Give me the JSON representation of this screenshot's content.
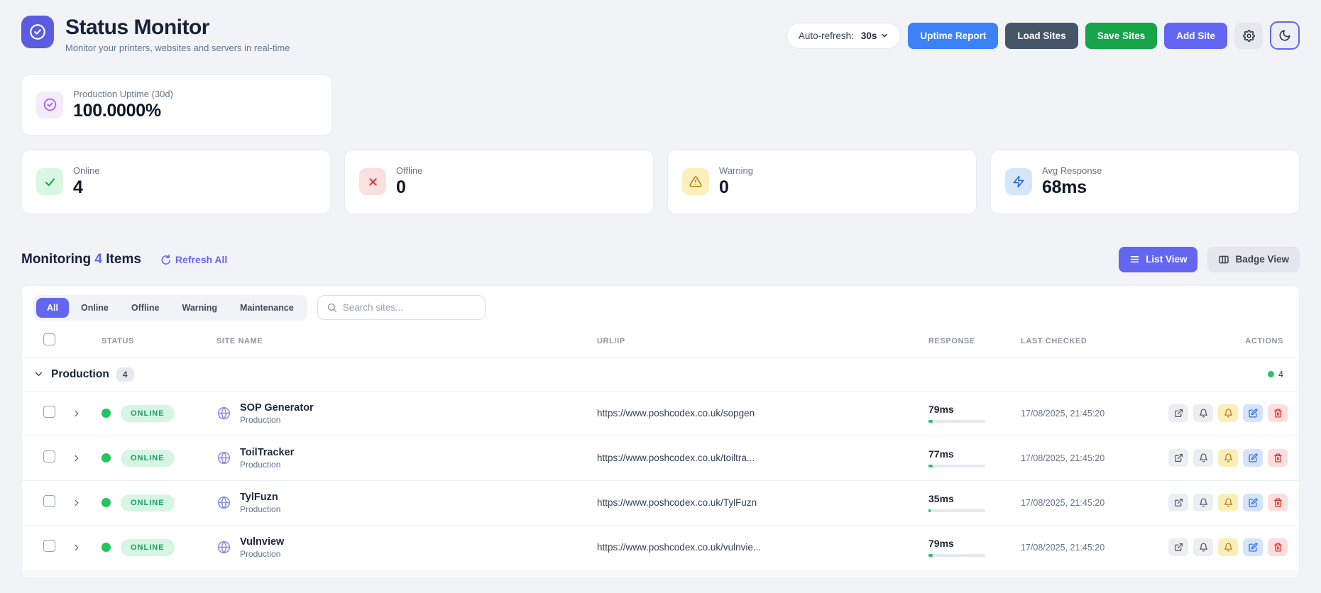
{
  "header": {
    "title": "Status Monitor",
    "subtitle": "Monitor your printers, websites and servers in real-time",
    "auto_refresh": {
      "label": "Auto-refresh:",
      "value": "30s"
    },
    "buttons": {
      "uptime_report": "Uptime Report",
      "load_sites": "Load Sites",
      "save_sites": "Save Sites",
      "add_site": "Add Site"
    },
    "icons": {
      "settings": "gear-icon",
      "theme": "moon-icon"
    }
  },
  "uptime_card": {
    "label": "Production Uptime (30d)",
    "value": "100.0000%"
  },
  "stats": [
    {
      "label": "Online",
      "value": "4",
      "icon": "check-icon"
    },
    {
      "label": "Offline",
      "value": "0",
      "icon": "x-icon"
    },
    {
      "label": "Warning",
      "value": "0",
      "icon": "warning-triangle-icon"
    },
    {
      "label": "Avg Response",
      "value": "68ms",
      "icon": "lightning-bolt-icon"
    }
  ],
  "monitoring": {
    "prefix": "Monitoring",
    "count": "4",
    "suffix": "Items",
    "refresh_all": "Refresh All",
    "list_view": "List View",
    "badge_view": "Badge View"
  },
  "filters": {
    "tabs": [
      "All",
      "Online",
      "Offline",
      "Warning",
      "Maintenance"
    ],
    "active_tab": "All",
    "search_placeholder": "Search sites..."
  },
  "table": {
    "headers": [
      "STATUS",
      "SITE NAME",
      "URL/IP",
      "RESPONSE",
      "LAST CHECKED",
      "ACTIONS"
    ],
    "group": {
      "name": "Production",
      "count": "4",
      "online_count": "4"
    },
    "rows": [
      {
        "status": "ONLINE",
        "name": "SOP Generator",
        "env": "Production",
        "url": "https://www.poshcodex.co.uk/sopgen",
        "response": "79ms",
        "response_pct": 7.9,
        "last_checked": "17/08/2025, 21:45:20"
      },
      {
        "status": "ONLINE",
        "name": "ToilTracker",
        "env": "Production",
        "url": "https://www.poshcodex.co.uk/toiltra...",
        "response": "77ms",
        "response_pct": 7.7,
        "last_checked": "17/08/2025, 21:45:20"
      },
      {
        "status": "ONLINE",
        "name": "TylFuzn",
        "env": "Production",
        "url": "https://www.poshcodex.co.uk/TylFuzn",
        "response": "35ms",
        "response_pct": 3.5,
        "last_checked": "17/08/2025, 21:45:20"
      },
      {
        "status": "ONLINE",
        "name": "Vulnview",
        "env": "Production",
        "url": "https://www.poshcodex.co.uk/vulnvie...",
        "response": "79ms",
        "response_pct": 7.9,
        "last_checked": "17/08/2025, 21:45:20"
      }
    ]
  },
  "colors": {
    "accent_indigo": "#6366f1",
    "blue": "#3b82f6",
    "dark_slate": "#475569",
    "green": "#16a34a",
    "online_green": "#22c55e",
    "page_bg": "#f1f3f6"
  }
}
